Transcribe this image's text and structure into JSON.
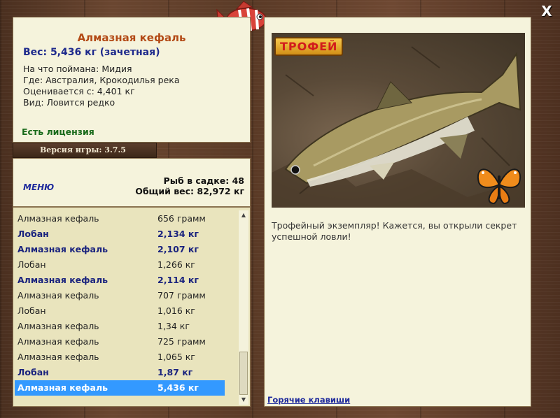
{
  "close": "X",
  "catch": {
    "name": "Алмазная кефаль",
    "weight": "Вес: 5,436 кг (зачетная)",
    "bait": "На что поймана: Мидия",
    "place": "Где: Австралия, Крокодилья река",
    "valued": "Оценивается с: 4,401 кг",
    "kind": "Вид: Ловится редко",
    "license": "Есть лицензия"
  },
  "version": "Версия игры: 3.7.5",
  "stats": {
    "menu": "МЕНЮ",
    "in_net": "Рыб в садке: 48",
    "total_weight": "Общий вес: 82,972 кг"
  },
  "rows": [
    {
      "name": "Алмазная кефаль",
      "value": "656 грамм",
      "bold": false
    },
    {
      "name": "Лобан",
      "value": "2,134 кг",
      "bold": true
    },
    {
      "name": "Алмазная кефаль",
      "value": "2,107 кг",
      "bold": true
    },
    {
      "name": "Лобан",
      "value": "1,266 кг",
      "bold": false
    },
    {
      "name": "Алмазная кефаль",
      "value": "2,114 кг",
      "bold": true
    },
    {
      "name": "Алмазная кефаль",
      "value": "707 грамм",
      "bold": false
    },
    {
      "name": "Лобан",
      "value": "1,016 кг",
      "bold": false
    },
    {
      "name": "Алмазная кефаль",
      "value": "1,34 кг",
      "bold": false
    },
    {
      "name": "Алмазная кефаль",
      "value": "725 грамм",
      "bold": false
    },
    {
      "name": "Алмазная кефаль",
      "value": "1,065 кг",
      "bold": false
    },
    {
      "name": "Лобан",
      "value": "1,87 кг",
      "bold": true
    },
    {
      "name": "Алмазная кефаль",
      "value": "5,436 кг",
      "bold": true,
      "selected": true
    }
  ],
  "trophy": {
    "badge": "ТРОФЕЙ",
    "description": "Трофейный экземпляр! Кажется, вы открыли секрет успешной ловли!"
  },
  "hotkeys": "Горячие клавиши"
}
